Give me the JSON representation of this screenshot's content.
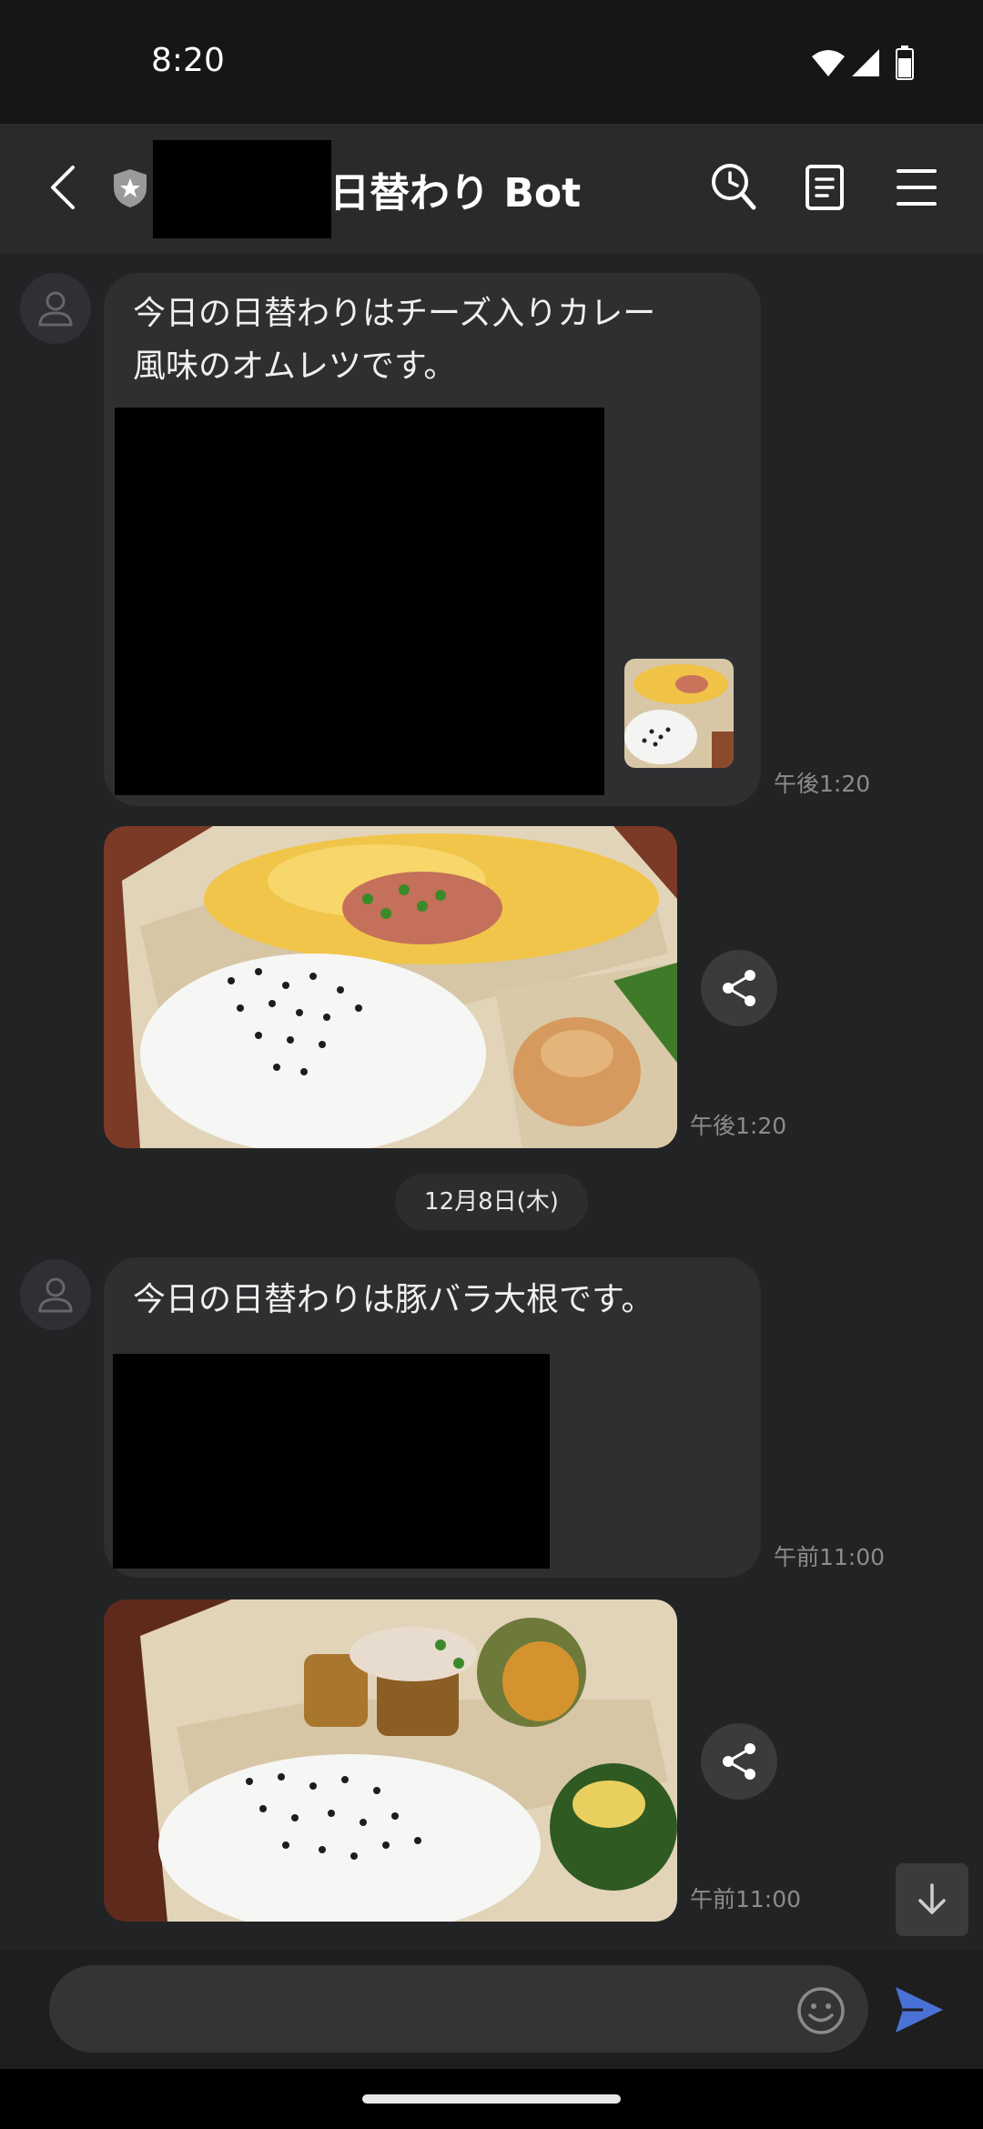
{
  "status_bar": {
    "time": "8:20"
  },
  "header": {
    "title": "日替わり Bot"
  },
  "messages": [
    {
      "text_line1": "今日の日替わりはチーズ入りカレー",
      "text_line2": "風味のオムレツです。",
      "time": "午後1:20"
    },
    {
      "photo": "omelet-bento-photo",
      "time": "午後1:20"
    },
    {
      "text_line1": "今日の日替わりは豚バラ大根です。",
      "time": "午前11:00"
    },
    {
      "photo": "pork-daikon-bento-photo",
      "time": "午前11:00"
    }
  ],
  "date_separator": "12月8日(木)",
  "input": {
    "placeholder": ""
  },
  "colors": {
    "background": "#222325",
    "bubble": "#2e2f31",
    "send_accent": "#4a72d6"
  }
}
